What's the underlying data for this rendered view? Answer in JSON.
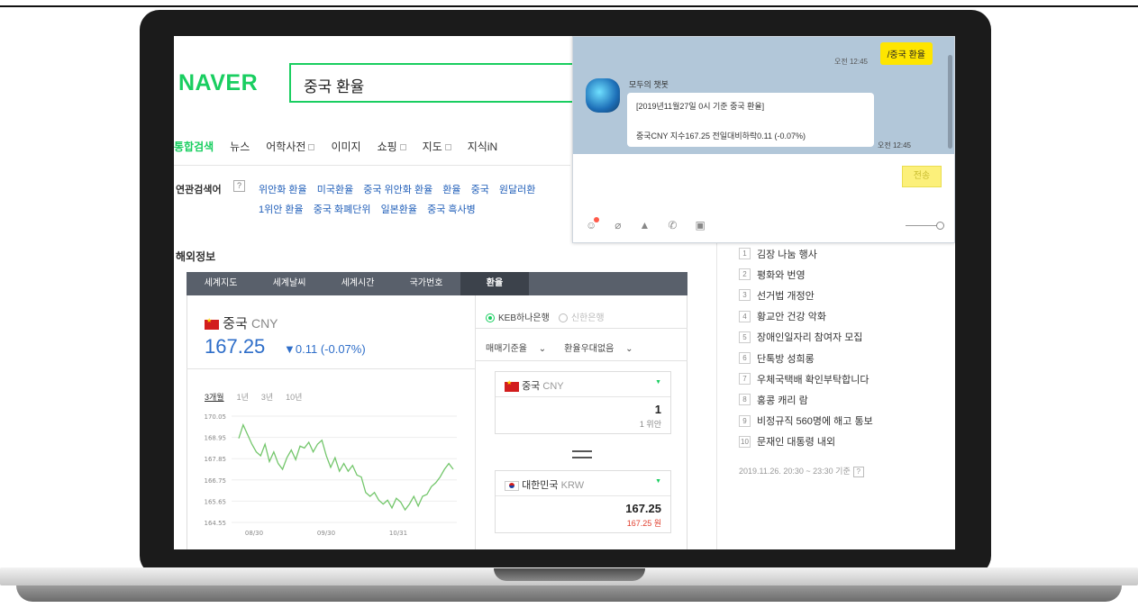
{
  "brand": "NAVER",
  "search": {
    "query": "중국 환율"
  },
  "tabs": [
    "통합검색",
    "뉴스",
    "어학사전",
    "이미지",
    "쇼핑",
    "지도",
    "지식iN"
  ],
  "related": {
    "title": "연관검색어",
    "help": "?",
    "row1": [
      "위안화 환율",
      "미국환율",
      "중국 위안화 환율",
      "환율",
      "중국",
      "원달러환"
    ],
    "row2": [
      "1위안 환율",
      "중국 화폐단위",
      "일본환율",
      "중국 흑사병"
    ]
  },
  "section_title": "해외정보",
  "fx_tabs": [
    "세계지도",
    "세계날씨",
    "세계시간",
    "국가번호",
    "환율"
  ],
  "currency": {
    "name": "중국",
    "code": "CNY",
    "price": "167.25",
    "change": "▼0.11 (-0.07%)",
    "periods": [
      "3개월",
      "1년",
      "3년",
      "10년"
    ]
  },
  "chart_data": {
    "type": "line",
    "y_ticks": [
      "170.05",
      "168.95",
      "167.85",
      "166.75",
      "165.65",
      "164.55"
    ],
    "x_ticks": [
      "08/30",
      "09/30",
      "10/31"
    ],
    "ylim": [
      164.55,
      170.05
    ],
    "values": [
      168.9,
      169.6,
      169.1,
      168.6,
      168.2,
      168.0,
      168.6,
      167.7,
      168.2,
      167.6,
      167.3,
      167.9,
      168.3,
      167.8,
      168.5,
      168.4,
      168.7,
      168.2,
      168.6,
      168.8,
      168.0,
      167.4,
      167.9,
      167.2,
      167.6,
      167.2,
      167.5,
      167.0,
      166.9,
      166.1,
      165.9,
      166.1,
      165.7,
      165.5,
      165.7,
      165.3,
      165.8,
      165.6,
      165.2,
      165.5,
      165.9,
      165.4,
      165.9,
      166.0,
      166.4,
      166.6,
      166.9,
      167.3,
      167.6,
      167.3
    ],
    "line_color": "#73c66b"
  },
  "banks": {
    "selected": "KEB하나은행",
    "other": "신한은행"
  },
  "rate_options": [
    "매매기준율",
    "환율우대없음"
  ],
  "converter": {
    "from": {
      "name": "중국",
      "code": "CNY",
      "value": "1",
      "sub": "1 위안"
    },
    "to": {
      "name": "대한민국",
      "code": "KRW",
      "value": "167.25",
      "sub": "167.25 원"
    }
  },
  "ranking": {
    "items": [
      {
        "num": "1",
        "label": "김장 나눔 행사"
      },
      {
        "num": "2",
        "label": "평화와 번영"
      },
      {
        "num": "3",
        "label": "선거법 개정안"
      },
      {
        "num": "4",
        "label": "황교안 건강 악화"
      },
      {
        "num": "5",
        "label": "장애인일자리 참여자 모집"
      },
      {
        "num": "6",
        "label": "단톡방 성희롱"
      },
      {
        "num": "7",
        "label": "우체국택배 확인부탁합니다"
      },
      {
        "num": "8",
        "label": "홍콩 캐리 람"
      },
      {
        "num": "9",
        "label": "비정규직 560명에 해고 통보"
      },
      {
        "num": "10",
        "label": "문재인 대통령 내외"
      }
    ],
    "time": "2019.11.26. 20:30 ~ 23:30 기준",
    "help": "?"
  },
  "chat": {
    "my_message": "/중국 환율",
    "my_time": "오전 12:45",
    "bot_name": "모두의 챗봇",
    "bot_line1": "[2019년11월27일 0시 기준 중국 환율]",
    "bot_line2": "중국CNY  지수167.25  전일대비하락0.11 (-0.07%)",
    "bot_time": "오전 12:45",
    "send_label": "전송",
    "tools": [
      "emoji-icon",
      "attach-icon",
      "image-icon",
      "call-icon",
      "calendar-icon"
    ]
  },
  "colors": {
    "naver_green": "#19ce60",
    "price_blue": "#2e6ec9",
    "chat_bg": "#b2c7d9",
    "bubble_yellow": "#fee500"
  }
}
